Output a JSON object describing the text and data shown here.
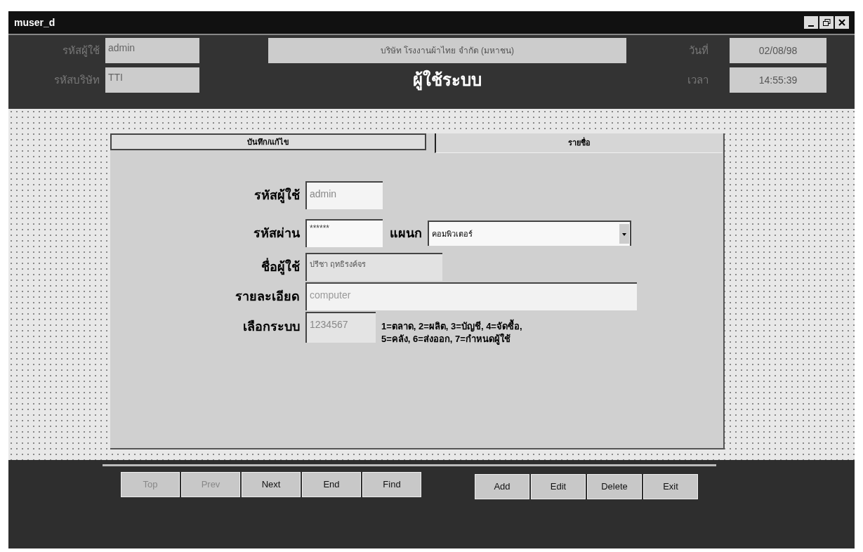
{
  "window": {
    "title": "muser_d"
  },
  "header": {
    "user_label": "รหัสผู้ใช้",
    "user_value": "admin",
    "company_label": "รหัสบริษัท",
    "company_value": "TTI",
    "company_name": "บริษัท โรงงานผ้าไทย จำกัด (มหาชน)",
    "title": "ผู้ใช้ระบบ",
    "date_label": "วันที่",
    "date_value": "02/08/98",
    "time_label": "เวลา",
    "time_value": "14:55:39"
  },
  "tabs": [
    {
      "label": "บันทึก/แก้ไข",
      "selected": true
    },
    {
      "label": "รายชื่อ",
      "selected": false
    }
  ],
  "form": {
    "user_id": {
      "label": "รหัสผู้ใช้",
      "value": "admin"
    },
    "password": {
      "label": "รหัสผ่าน",
      "value": "******"
    },
    "department": {
      "label": "แผนก",
      "value": "คอมพิวเตอร์"
    },
    "user_name": {
      "label": "ชื่อผู้ใช้",
      "value": "ปรีชา ฤทธิรงค์จร"
    },
    "details": {
      "label": "รายละเอียด",
      "value": "computer"
    },
    "systems": {
      "label": "เลือกระบบ",
      "value": "1234567",
      "hint": "1=ตลาด, 2=ผลิต, 3=บัญชี, 4=จัดซื้อ, 5=คลัง, 6=ส่งออก, 7=กำหนดผู้ใช้"
    }
  },
  "nav_buttons": [
    {
      "label": "Top",
      "disabled": true
    },
    {
      "label": "Prev",
      "disabled": true
    },
    {
      "label": "Next",
      "disabled": false
    },
    {
      "label": "End",
      "disabled": false
    },
    {
      "label": "Find",
      "disabled": false
    }
  ],
  "action_buttons": [
    {
      "label": "Add",
      "disabled": false
    },
    {
      "label": "Edit",
      "disabled": false
    },
    {
      "label": "Delete",
      "disabled": false
    },
    {
      "label": "Exit",
      "disabled": false
    }
  ]
}
